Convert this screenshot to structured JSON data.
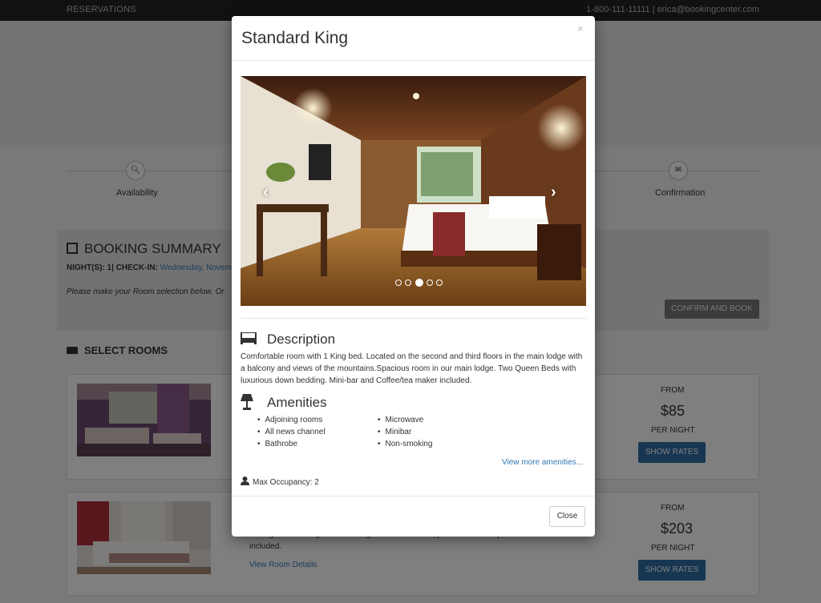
{
  "topbar": {
    "brand": "RESERVATIONS",
    "contact": "1-800-111-11111 |  erica@bookingcenter.com"
  },
  "steps": {
    "availability": "Availability",
    "confirmation": "Confirmation"
  },
  "summary": {
    "title": "BOOKING SUMMARY",
    "nights_label": "NIGHT(S):  1| CHECK-IN: ",
    "checkin": "Wednesday, Novem",
    "note": "Please make your Room selection below. Or",
    "confirm": "CONFIRM AND BOOK"
  },
  "select_rooms": "SELECT ROOMS",
  "rooms": [
    {
      "from": "FROM",
      "price": "$85",
      "per": "PER NIGHT",
      "rates": "SHOW RATES"
    },
    {
      "from": "FROM",
      "price": "$203",
      "per": "PER NIGHT",
      "rates": "SHOW RATES",
      "desc_tail": "included.",
      "desc_partial": "extra guests. Sitting area with large desk. Television, jacuzzi tub and spa amenities",
      "details": "View Room Details"
    }
  ],
  "modal": {
    "title": "Standard King",
    "close_x": "×",
    "description_heading": "Description",
    "description": "Comfortable room with 1 King bed. Located on the second and third floors in the main lodge with a balcony and views of the mountains.Spacious room in our main lodge. Two Queen Beds with luxurious down bedding. Mini-bar and Coffee/tea maker included.",
    "amenities_heading": "Amenities",
    "amenities_left": [
      "Adjoining rooms",
      "All news channel",
      "Bathrobe"
    ],
    "amenities_right": [
      "Microwave",
      "Minibar",
      "Non-smoking"
    ],
    "more_amenities": "View more amenities...",
    "occupancy": "Max Occupancy: 2",
    "close": "Close",
    "carousel": {
      "prev": "‹",
      "next": "›",
      "slides": 5,
      "active": 3
    }
  },
  "colors": {
    "primary": "#2e6da4",
    "link": "#337ab7",
    "topbar": "#222222"
  }
}
